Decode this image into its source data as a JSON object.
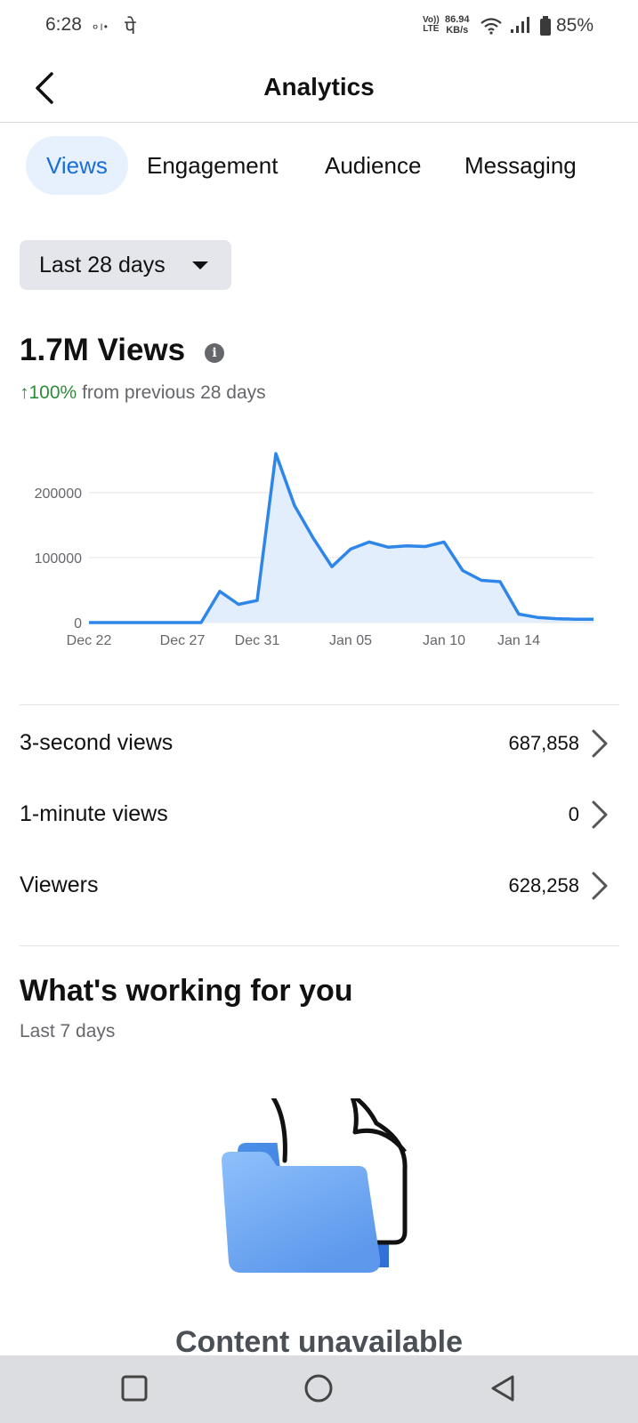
{
  "status": {
    "time": "6:28",
    "tiny": "०।•",
    "dev": "पे",
    "volte_top": "Vo))",
    "volte_bottom": "LTE",
    "speed_value": "86.94",
    "speed_unit": "KB/s",
    "battery": "85%"
  },
  "header": {
    "title": "Analytics"
  },
  "tabs": [
    {
      "label": "Views",
      "active": true
    },
    {
      "label": "Engagement",
      "active": false
    },
    {
      "label": "Audience",
      "active": false
    },
    {
      "label": "Messaging",
      "active": false
    }
  ],
  "date_range": {
    "label": "Last 28 days"
  },
  "metric": {
    "value": "1.7M Views",
    "change_value": "↑100%",
    "change_text": "from previous 28 days"
  },
  "colors": {
    "accent": "#1a6ed8",
    "line": "#2f86e9",
    "fill": "#e3eefc",
    "positive": "#2e8b3b"
  },
  "chart_data": {
    "type": "area",
    "x": [
      "Dec 22",
      "Dec 23",
      "Dec 24",
      "Dec 25",
      "Dec 26",
      "Dec 27",
      "Dec 28",
      "Dec 29",
      "Dec 30",
      "Dec 31",
      "Jan 01",
      "Jan 02",
      "Jan 03",
      "Jan 04",
      "Jan 05",
      "Jan 06",
      "Jan 07",
      "Jan 08",
      "Jan 09",
      "Jan 10",
      "Jan 11",
      "Jan 12",
      "Jan 13",
      "Jan 14",
      "Jan 15",
      "Jan 16",
      "Jan 17",
      "Jan 18"
    ],
    "values": [
      0,
      0,
      0,
      0,
      0,
      0,
      0,
      48000,
      28000,
      34000,
      260000,
      180000,
      130000,
      86000,
      113000,
      124000,
      116000,
      118000,
      117000,
      124000,
      80000,
      65000,
      63000,
      13000,
      8000,
      6000,
      5000,
      5000
    ],
    "x_ticks": [
      "Dec 22",
      "Dec 27",
      "Dec 31",
      "Jan 05",
      "Jan 10",
      "Jan 14"
    ],
    "y_ticks": [
      "0",
      "100000",
      "200000"
    ],
    "ylim": [
      0,
      260000
    ],
    "grid": true
  },
  "stats": [
    {
      "label": "3-second views",
      "value": "687,858"
    },
    {
      "label": "1-minute views",
      "value": "0"
    },
    {
      "label": "Viewers",
      "value": "628,258"
    }
  ],
  "working": {
    "title": "What's working for you",
    "subtitle": "Last 7 days",
    "empty_text": "Content unavailable"
  },
  "nav": {
    "icons": [
      "recent-apps-icon",
      "home-icon",
      "back-nav-icon"
    ]
  }
}
